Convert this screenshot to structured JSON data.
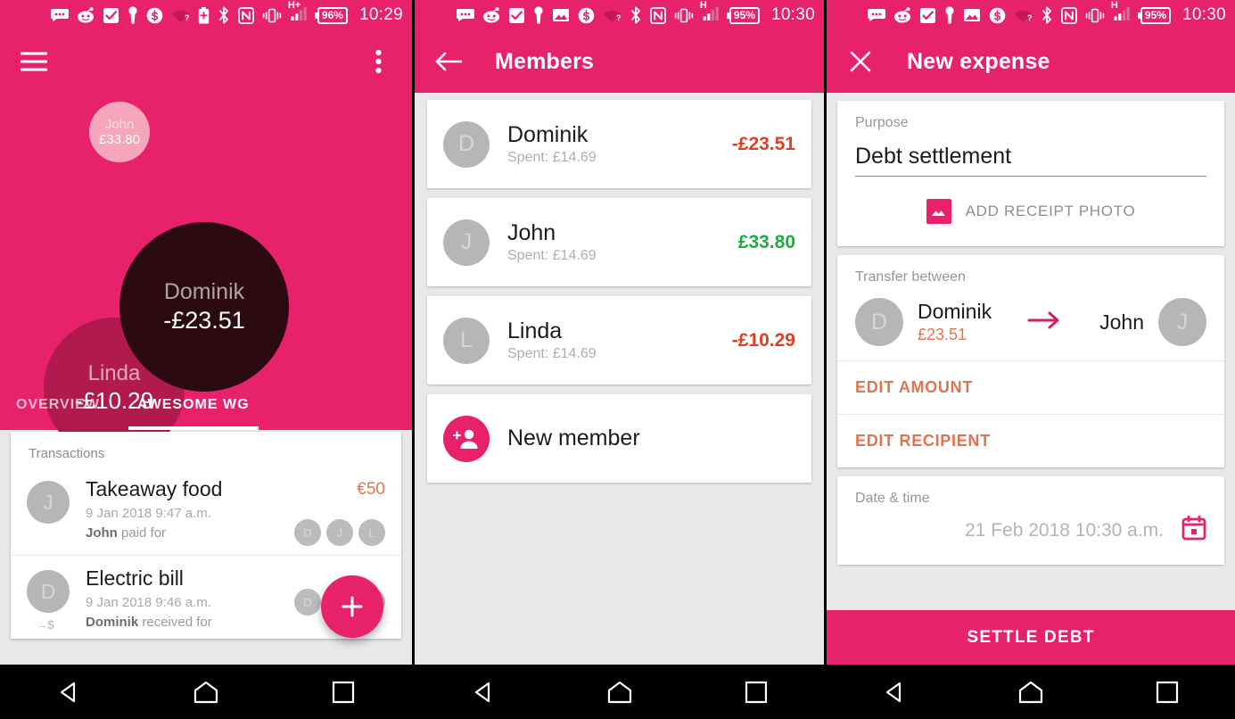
{
  "accent": "#e8216b",
  "colors": {
    "pink": "#e8216b",
    "orange": "#e2734f",
    "red": "#e03e22",
    "green": "#1faa42",
    "dark_bubble": "#2b0a12",
    "linda_bubble": "#b01a4e",
    "john_bubble": "#f5a6bd"
  },
  "panel1": {
    "statusbar": {
      "time": "10:29",
      "battery": "96%",
      "network": "H+",
      "icons": [
        "message-icon",
        "reddit-icon",
        "checkbox-icon",
        "key-icon",
        "dollar-icon",
        "wifi-question-icon",
        "battery-plus-icon",
        "bluetooth-icon",
        "nfc-icon",
        "vibrate-icon",
        "signal-icon"
      ]
    },
    "appbar": {
      "menu": "menu-icon",
      "overflow": "overflow-icon"
    },
    "bubbles": [
      {
        "name": "John",
        "amount": "£33.80",
        "value": 33.8
      },
      {
        "name": "Dominik",
        "amount": "-£23.51",
        "value": -23.51
      },
      {
        "name": "Linda",
        "amount": "-£10.29",
        "value": -10.29
      }
    ],
    "tabs": [
      {
        "label": "OVERVIEW",
        "active": false
      },
      {
        "label": "AWESOME WG",
        "active": true
      }
    ],
    "transactions": {
      "header": "Transactions",
      "rows": [
        {
          "initial": "J",
          "title": "Takeaway food",
          "date": "9 Jan 2018 9:47 a.m.",
          "actor": "John",
          "action": " paid for",
          "amount": "€50",
          "participants": [
            "D",
            "J",
            "L"
          ],
          "lead_icon": ""
        },
        {
          "initial": "D",
          "title": "Electric bill",
          "date": "9 Jan 2018 9:46 a.m.",
          "actor": "Dominik",
          "action": " received for",
          "amount": "",
          "participants": [
            "D",
            "J",
            "L"
          ],
          "lead_icon": "→$"
        }
      ]
    },
    "fab": "add-icon"
  },
  "panel2": {
    "statusbar": {
      "time": "10:30",
      "battery": "95%",
      "network": "H"
    },
    "appbar": {
      "back": "back-arrow-icon",
      "title": "Members"
    },
    "members": [
      {
        "initial": "D",
        "name": "Dominik",
        "spent": "Spent: £14.69",
        "balance": "-£23.51",
        "sign": "neg"
      },
      {
        "initial": "J",
        "name": "John",
        "spent": "Spent: £14.69",
        "balance": "£33.80",
        "sign": "pos"
      },
      {
        "initial": "L",
        "name": "Linda",
        "spent": "Spent: £14.69",
        "balance": "-£10.29",
        "sign": "neg"
      }
    ],
    "new_member_label": "New member"
  },
  "panel3": {
    "statusbar": {
      "time": "10:30",
      "battery": "95%",
      "network": "H"
    },
    "appbar": {
      "close": "close-icon",
      "title": "New expense"
    },
    "purpose": {
      "label": "Purpose",
      "value": "Debt settlement",
      "receipt_label": "ADD RECEIPT PHOTO"
    },
    "transfer": {
      "label": "Transfer between",
      "from": {
        "initial": "D",
        "name": "Dominik",
        "amount": "£23.51"
      },
      "to": {
        "initial": "J",
        "name": "John"
      },
      "edit_amount": "EDIT AMOUNT",
      "edit_recipient": "EDIT RECIPIENT"
    },
    "datetime": {
      "label": "Date & time",
      "value": "21 Feb 2018 10:30 a.m."
    },
    "submit": "SETTLE DEBT"
  },
  "navbar": {
    "back": "nav-back-icon",
    "home": "nav-home-icon",
    "recents": "nav-recents-icon"
  }
}
